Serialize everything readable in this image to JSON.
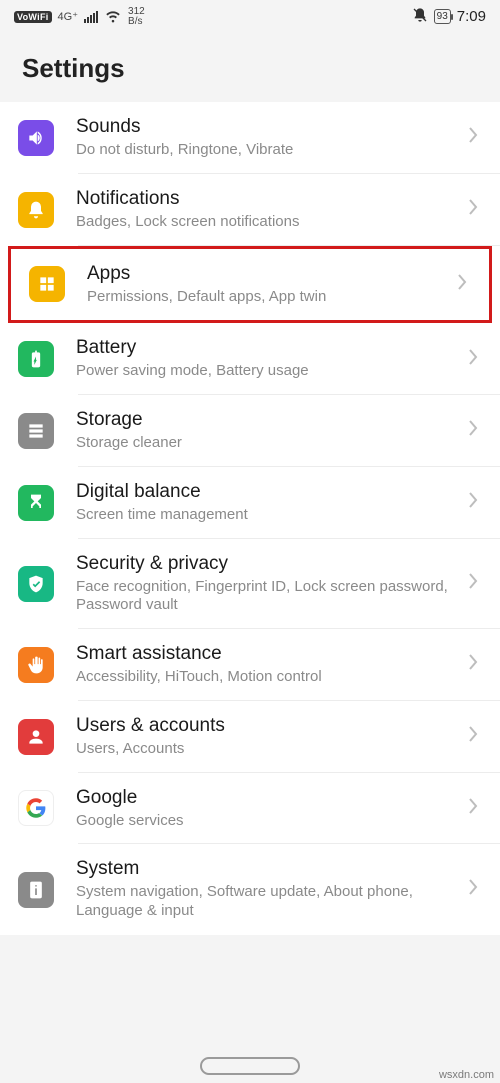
{
  "status": {
    "vowifi": "VoWiFi",
    "net_gen": "4G⁺",
    "speed_top": "312",
    "speed_bot": "B/s",
    "battery": "93",
    "time": "7:09"
  },
  "header": {
    "title": "Settings"
  },
  "rows": [
    {
      "key": "sounds",
      "title": "Sounds",
      "sub": "Do not disturb, Ringtone, Vibrate",
      "color": "bg-purple"
    },
    {
      "key": "notifications",
      "title": "Notifications",
      "sub": "Badges, Lock screen notifications",
      "color": "bg-yellow"
    },
    {
      "key": "apps",
      "title": "Apps",
      "sub": "Permissions, Default apps, App twin",
      "color": "bg-yellow",
      "highlighted": true
    },
    {
      "key": "battery",
      "title": "Battery",
      "sub": "Power saving mode, Battery usage",
      "color": "bg-green"
    },
    {
      "key": "storage",
      "title": "Storage",
      "sub": "Storage cleaner",
      "color": "bg-grey"
    },
    {
      "key": "digital-balance",
      "title": "Digital balance",
      "sub": "Screen time management",
      "color": "bg-green"
    },
    {
      "key": "security",
      "title": "Security & privacy",
      "sub": "Face recognition, Fingerprint ID, Lock screen password, Password vault",
      "color": "bg-teal"
    },
    {
      "key": "smart-assistance",
      "title": "Smart assistance",
      "sub": "Accessibility, HiTouch, Motion control",
      "color": "bg-orange"
    },
    {
      "key": "users",
      "title": "Users & accounts",
      "sub": "Users, Accounts",
      "color": "bg-red"
    },
    {
      "key": "google",
      "title": "Google",
      "sub": "Google services",
      "color": "bg-white"
    },
    {
      "key": "system",
      "title": "System",
      "sub": "System navigation, Software update, About phone, Language & input",
      "color": "bg-grey"
    }
  ],
  "attribution": "wsxdn.com"
}
